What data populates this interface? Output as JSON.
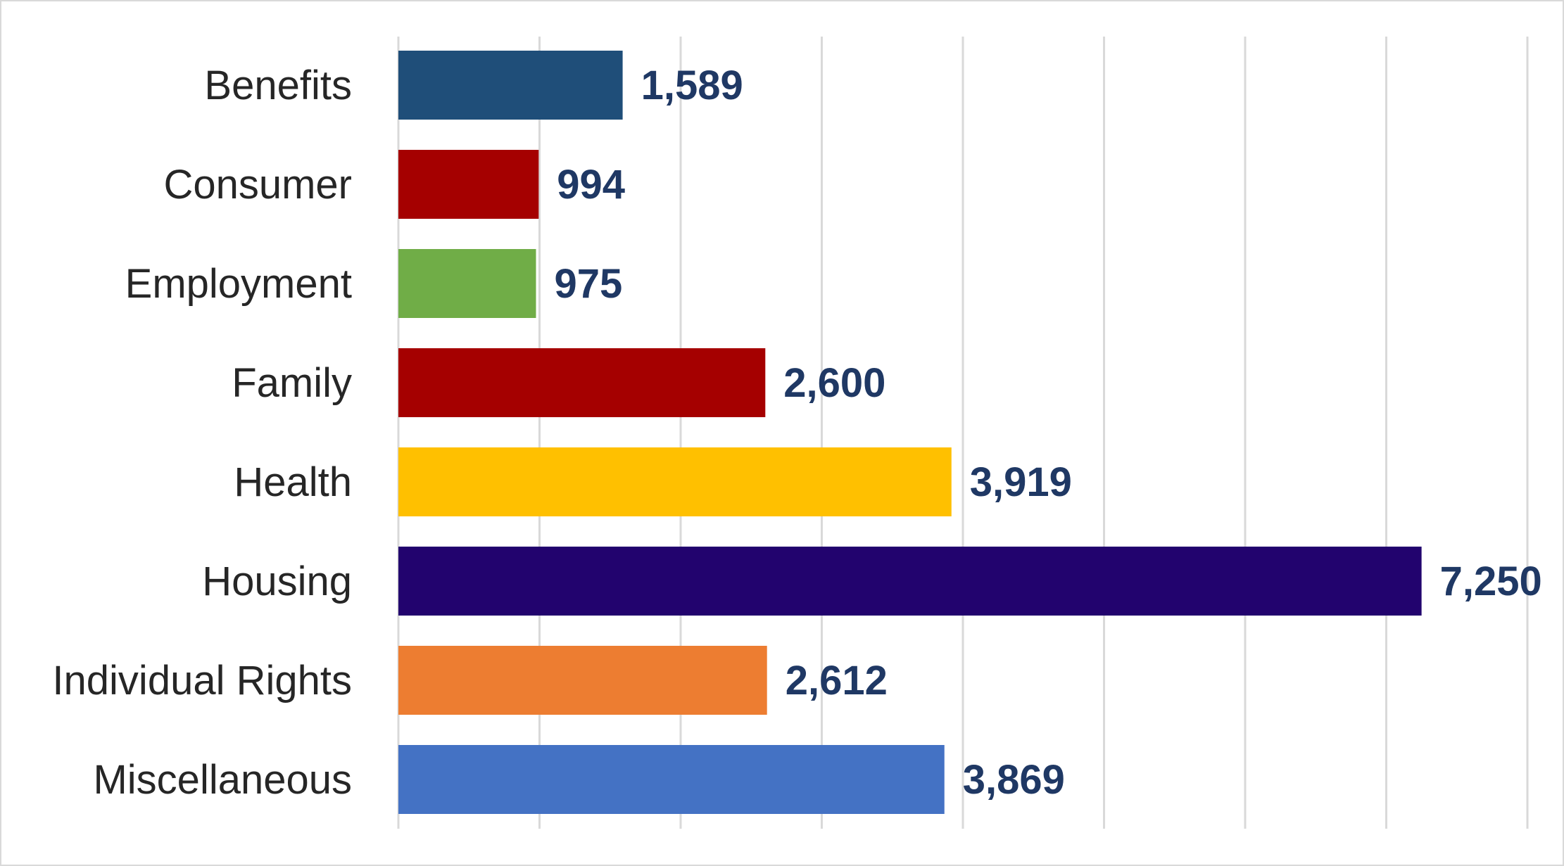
{
  "chart_data": {
    "type": "bar",
    "orientation": "horizontal",
    "title": "",
    "xlabel": "",
    "ylabel": "",
    "xlim": [
      0,
      8000
    ],
    "grid": true,
    "grid_step": 1000,
    "tick_labels_shown": false,
    "legend": "none",
    "categories": [
      "Benefits",
      "Consumer",
      "Employment",
      "Family",
      "Health",
      "Housing",
      "Individual Rights",
      "Miscellaneous"
    ],
    "values": [
      1589,
      994,
      975,
      2600,
      3919,
      7250,
      2612,
      3869
    ],
    "value_labels": [
      "1,589",
      "994",
      "975",
      "2,600",
      "3,919",
      "7,250",
      "2,612",
      "3,869"
    ],
    "colors": [
      "#1f4e79",
      "#a50000",
      "#70ad47",
      "#a50000",
      "#ffc000",
      "#22036e",
      "#ed7d31",
      "#4472c4"
    ],
    "label_color": "#1f3864"
  }
}
